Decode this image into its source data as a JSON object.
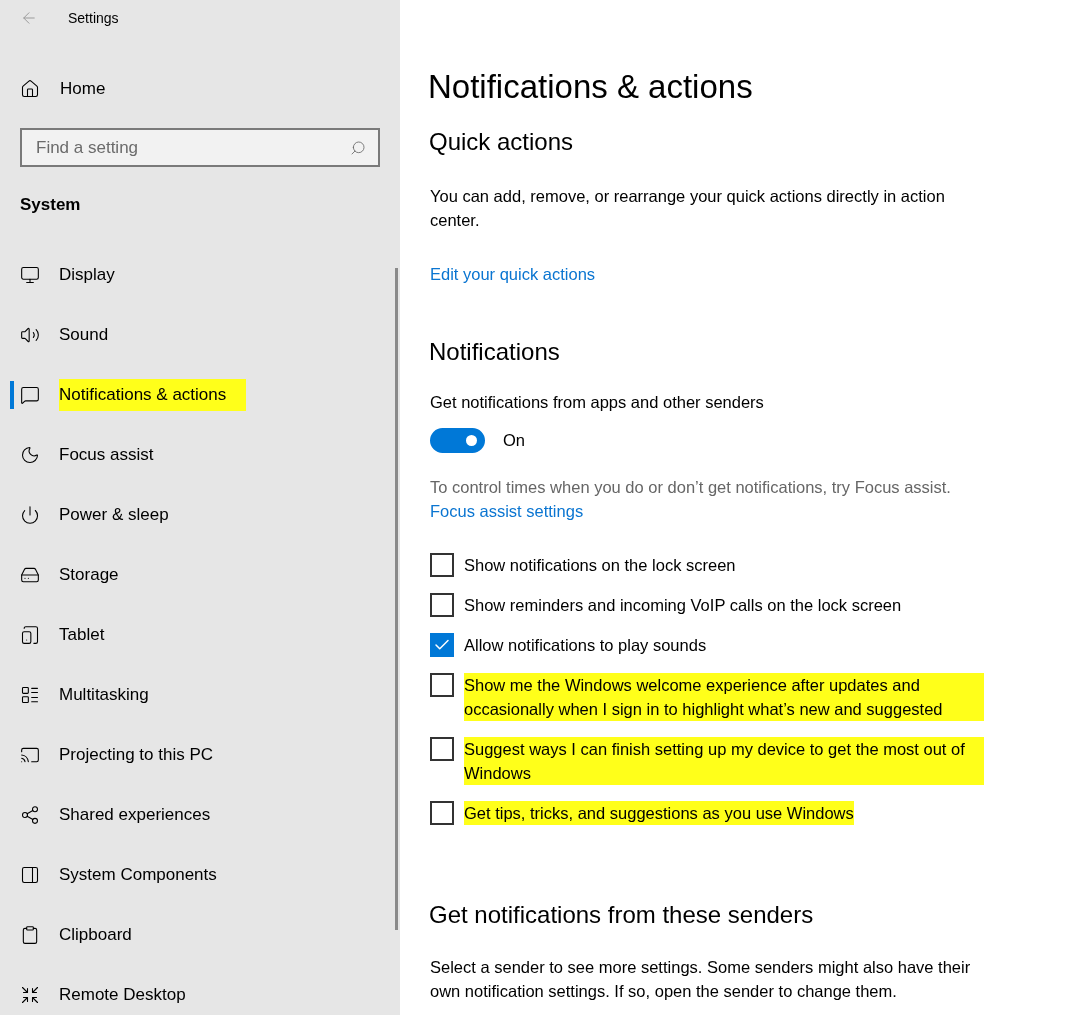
{
  "window": {
    "title": "Settings"
  },
  "sidebar": {
    "home": "Home",
    "search": {
      "placeholder": "Find a setting"
    },
    "section": "System",
    "items": [
      {
        "label": "Display",
        "selected": false,
        "highlighted": false
      },
      {
        "label": "Sound",
        "selected": false,
        "highlighted": false
      },
      {
        "label": "Notifications & actions",
        "selected": true,
        "highlighted": true
      },
      {
        "label": "Focus assist",
        "selected": false,
        "highlighted": false
      },
      {
        "label": "Power & sleep",
        "selected": false,
        "highlighted": false
      },
      {
        "label": "Storage",
        "selected": false,
        "highlighted": false
      },
      {
        "label": "Tablet",
        "selected": false,
        "highlighted": false
      },
      {
        "label": "Multitasking",
        "selected": false,
        "highlighted": false
      },
      {
        "label": "Projecting to this PC",
        "selected": false,
        "highlighted": false
      },
      {
        "label": "Shared experiences",
        "selected": false,
        "highlighted": false
      },
      {
        "label": "System Components",
        "selected": false,
        "highlighted": false
      },
      {
        "label": "Clipboard",
        "selected": false,
        "highlighted": false
      },
      {
        "label": "Remote Desktop",
        "selected": false,
        "highlighted": false
      }
    ]
  },
  "main": {
    "title": "Notifications & actions",
    "quick_actions": {
      "heading": "Quick actions",
      "description": "You can add, remove, or rearrange your quick actions directly in action center.",
      "link": "Edit your quick actions"
    },
    "notifications": {
      "heading": "Notifications",
      "toggle_caption": "Get notifications from apps and other senders",
      "toggle": {
        "on": true,
        "label": "On"
      },
      "hint": "To control times when you do or don’t get notifications, try Focus assist.",
      "link": "Focus assist settings",
      "options": [
        {
          "label": "Show notifications on the lock screen",
          "checked": false,
          "highlighted": false
        },
        {
          "label": "Show reminders and incoming VoIP calls on the lock screen",
          "checked": false,
          "highlighted": false
        },
        {
          "label": "Allow notifications to play sounds",
          "checked": true,
          "highlighted": false
        },
        {
          "label": "Show me the Windows welcome experience after updates and occasionally when I sign in to highlight what’s new and suggested",
          "checked": false,
          "highlighted": true
        },
        {
          "label": "Suggest ways I can finish setting up my device to get the most out of Windows",
          "checked": false,
          "highlighted": true
        },
        {
          "label": "Get tips, tricks, and suggestions as you use Windows",
          "checked": false,
          "highlighted": true
        }
      ]
    },
    "senders": {
      "heading": "Get notifications from these senders",
      "description": "Select a sender to see more settings. Some senders might also have their own notification settings. If so, open the sender to change them."
    }
  }
}
